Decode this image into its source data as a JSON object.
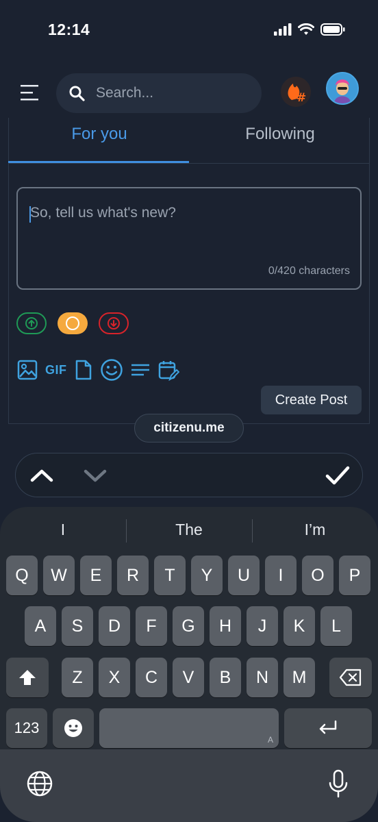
{
  "status_bar": {
    "time": "12:14"
  },
  "header": {
    "search_placeholder": "Search..."
  },
  "tabs": [
    {
      "label": "For you",
      "active": true
    },
    {
      "label": "Following",
      "active": false
    }
  ],
  "composer": {
    "placeholder": "So, tell us what's new?",
    "counter": "0/420 characters"
  },
  "toolbar": {
    "gif_label": "GIF",
    "create_post_label": "Create Post"
  },
  "browser": {
    "url": "citizenu.me"
  },
  "keyboard": {
    "suggestions": [
      "I",
      "The",
      "I’m"
    ],
    "row1": [
      "Q",
      "W",
      "E",
      "R",
      "T",
      "Y",
      "U",
      "I",
      "O",
      "P"
    ],
    "row2": [
      "A",
      "S",
      "D",
      "F",
      "G",
      "H",
      "J",
      "K",
      "L"
    ],
    "row3": [
      "Z",
      "X",
      "C",
      "V",
      "B",
      "N",
      "M"
    ],
    "numbers_label": "123",
    "space_hint": "A"
  },
  "colors": {
    "accent": "#3f8fe0",
    "upvote": "#1f9a56",
    "neutral": "#f5a93e",
    "downvote": "#d8232a",
    "icon_blue": "#3fa3e0"
  }
}
